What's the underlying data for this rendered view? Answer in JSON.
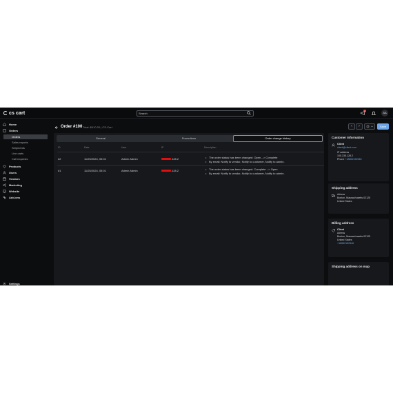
{
  "header": {
    "logo": "cs cart",
    "search_placeholder": "Search",
    "notification_count": "2",
    "avatar_initials": "AA"
  },
  "sidebar": {
    "items": [
      {
        "label": "Home",
        "icon": "home-icon"
      },
      {
        "label": "Orders",
        "icon": "orders-icon"
      },
      {
        "label": "Products",
        "icon": "products-icon"
      },
      {
        "label": "Users",
        "icon": "users-icon"
      },
      {
        "label": "Vendors",
        "icon": "vendors-icon"
      },
      {
        "label": "Marketing",
        "icon": "marketing-icon"
      },
      {
        "label": "Website",
        "icon": "website-icon"
      },
      {
        "label": "Add-ons",
        "icon": "addons-icon"
      }
    ],
    "orders_sub": [
      "Orders",
      "Sales reports",
      "Shipments",
      "Live carts",
      "Call requests"
    ],
    "settings_label": "Settings"
  },
  "order": {
    "title": "Order #100",
    "subtitle": "Total: $410.00 | CS-Cart",
    "save_label": "Save",
    "prev": "‹",
    "next": "›"
  },
  "tabs": [
    "General",
    "Promotions",
    "Order change history"
  ],
  "active_tab": "Order change history",
  "table": {
    "headers": [
      "ID",
      "Date",
      "User",
      "IP",
      "Description"
    ],
    "rows": [
      {
        "id": "#2",
        "date": "11/25/2024, 05:01",
        "user": "Admin Admin",
        "ip_suffix": ".128.2",
        "desc": [
          "The order status has been changed: Open --> Complete",
          "By email: Notify to vendor, Notify to customer, Notify to admin."
        ]
      },
      {
        "id": "#1",
        "date": "11/25/2024, 05:01",
        "user": "Admin Admin",
        "ip_suffix": ".128.2",
        "desc": [
          "The order status has been changed: Complete --> Open",
          "By email: Notify to vendor, Notify to customer, Notify to admin."
        ]
      }
    ]
  },
  "customer": {
    "heading": "Customer information",
    "name": "Client",
    "email": "client@client.com",
    "ip_label": "IP address",
    "ip": "105.235.128.2",
    "phone_label": "Phone",
    "phone": "+18652152546"
  },
  "shipping": {
    "heading": "Shipping address"
  },
  "billing": {
    "heading": "Billing address",
    "name": "Client",
    "line1": "Adress",
    "line2": "Boston, Massachusetts 02125",
    "country": "United States",
    "phone": "+18652152546"
  },
  "shipping_addr": {
    "line1": "Adress",
    "line2": "Boston, Massachusetts 02125",
    "country": "United States"
  },
  "map": {
    "heading": "Shipping address on map"
  },
  "colors": {
    "bg": "#0c0d0f",
    "panel": "#16181b",
    "accent": "#6ea6e8",
    "redaction": "#e01010"
  }
}
